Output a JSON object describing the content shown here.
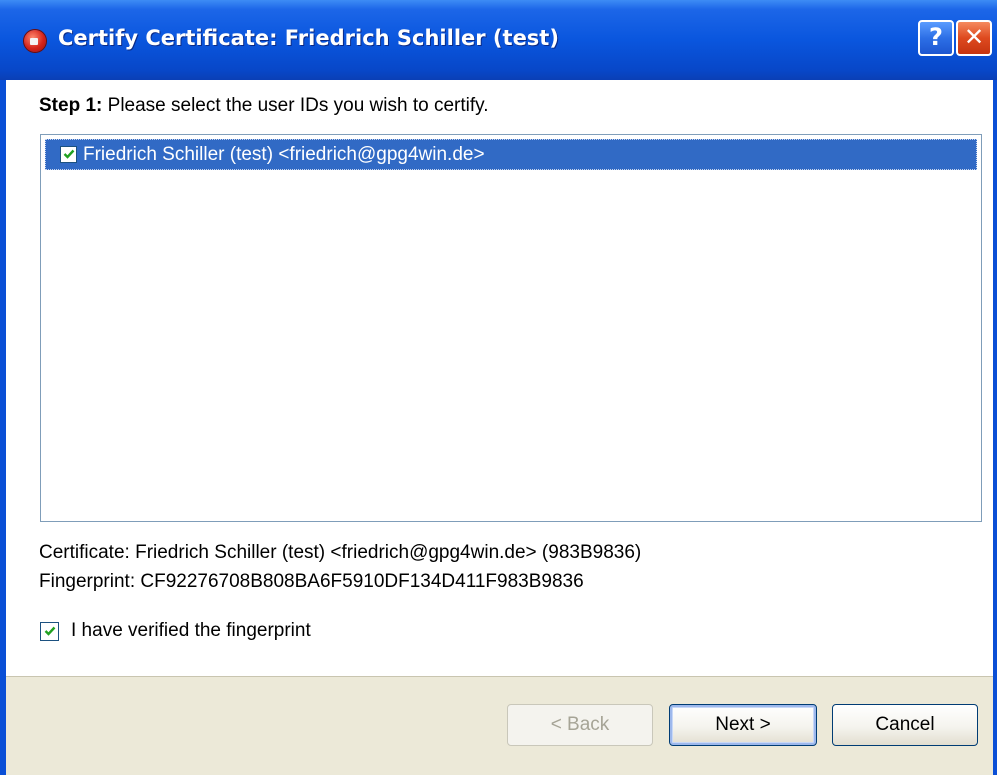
{
  "window": {
    "title": "Certify Certificate: Friedrich Schiller (test)",
    "help_glyph": "?",
    "close_glyph": "✕"
  },
  "step": {
    "prefix": "Step 1:",
    "text": "Please select the user IDs you wish to certify."
  },
  "user_ids": [
    {
      "label": "Friedrich Schiller (test) <friedrich@gpg4win.de>",
      "checked": true,
      "selected": true
    }
  ],
  "certificate_line": "Certificate: Friedrich Schiller (test) <friedrich@gpg4win.de> (983B9836)",
  "fingerprint_line": "Fingerprint: CF92276708B808BA6F5910DF134D411F983B9836",
  "verify": {
    "label": "I have verified the fingerprint",
    "checked": true
  },
  "buttons": {
    "back": "< Back",
    "next": "Next >",
    "cancel": "Cancel"
  },
  "icons": {
    "app": "gpa-app-icon",
    "help": "help-icon",
    "close": "close-icon",
    "check": "checkmark-icon"
  },
  "colors": {
    "titlebar": "#0a56de",
    "selection": "#316ac5",
    "button_bar": "#ece9d8",
    "close_button": "#de4a1f"
  }
}
